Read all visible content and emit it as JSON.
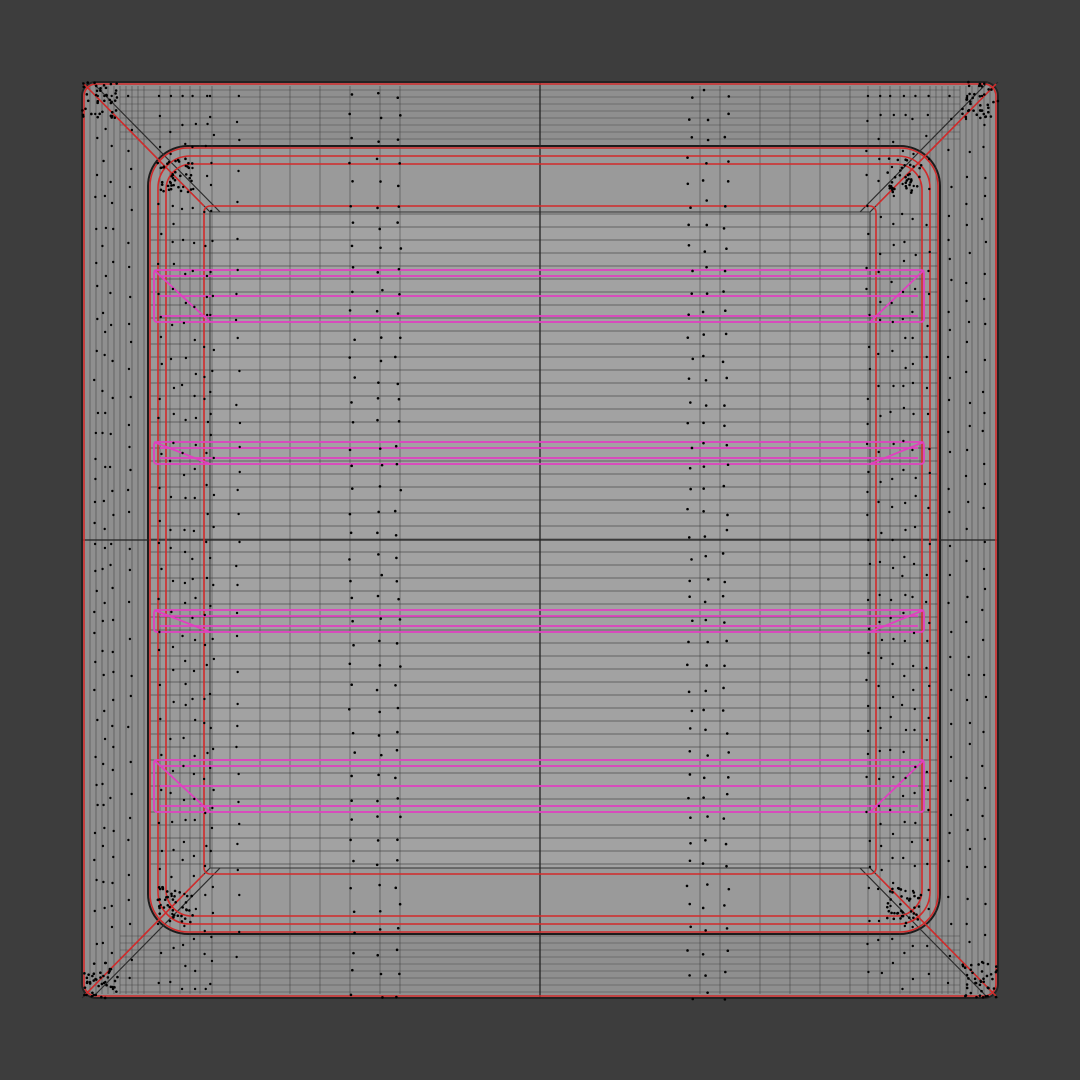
{
  "viewport": {
    "background_color": "#3d3d3d",
    "mesh_fill_color": "#8f8f8f",
    "edge_color": "#2a2a2a",
    "seam_color": "#d22a2a",
    "selected_edge_color": "#e040c0",
    "vertex_color": "#000000",
    "view": "top-orthographic",
    "shading": "wireframe-overlay",
    "shelf_count": 4
  }
}
